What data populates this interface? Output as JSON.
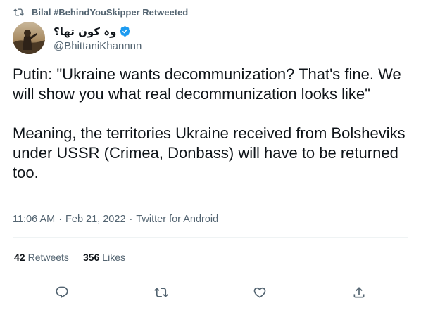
{
  "social_context": {
    "retweet_text": "Bilal #BehindYouSkipper Retweeted",
    "icon": "retweet-icon"
  },
  "author": {
    "display_name": "وہ کون تھا؟",
    "handle": "@BhittaniKhannnn",
    "verified": true,
    "verified_color": "#1d9bf0"
  },
  "tweet": {
    "lines": [
      "Putin: \"Ukraine wants decommunization? That's fine. We will show you what real decommunization looks like\"",
      "Meaning, the territories Ukraine received from Bolsheviks under USSR (Crimea, Donbass) will have to be returned too."
    ]
  },
  "meta": {
    "time": "11:06 AM",
    "separator": "·",
    "date": "Feb 21, 2022",
    "source": "Twitter for Android"
  },
  "stats": {
    "retweets_count": "42",
    "retweets_label": "Retweets",
    "likes_count": "356",
    "likes_label": "Likes"
  },
  "actions": [
    {
      "name": "reply",
      "icon": "reply-icon"
    },
    {
      "name": "retweet",
      "icon": "retweet-icon"
    },
    {
      "name": "like",
      "icon": "heart-icon"
    },
    {
      "name": "share",
      "icon": "share-icon"
    }
  ],
  "colors": {
    "primary_text": "#0f1419",
    "secondary_text": "#536471",
    "divider": "#eff3f4",
    "verified_blue": "#1d9bf0"
  }
}
